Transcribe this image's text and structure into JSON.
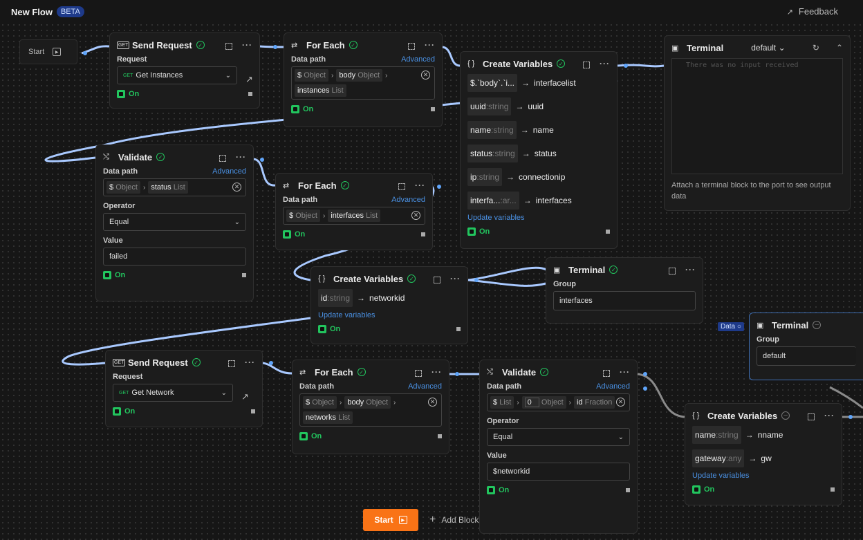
{
  "app": {
    "title": "New Flow",
    "badge": "BETA",
    "feedback": "Feedback"
  },
  "start_node": {
    "label": "Start"
  },
  "nodes": {
    "send1": {
      "title": "Send Request",
      "request_label": "Request",
      "method": "GET",
      "request_value": "Get Instances",
      "status": "On"
    },
    "foreach1": {
      "title": "For Each",
      "datapath_label": "Data path",
      "advanced": "Advanced",
      "chips": [
        [
          "$",
          "Object"
        ],
        [
          "body",
          "Object"
        ],
        [
          "instances",
          "List"
        ]
      ],
      "status": "On"
    },
    "createvars1": {
      "title": "Create Variables",
      "rows": [
        {
          "src": "$.`body`.`i...",
          "type": "",
          "target": "interfacelist"
        },
        {
          "src": "uuid",
          "type": ":string",
          "target": "uuid"
        },
        {
          "src": "name",
          "type": ":string",
          "target": "name"
        },
        {
          "src": "status",
          "type": ":string",
          "target": "status"
        },
        {
          "src": "ip",
          "type": ":string",
          "target": "connectionip"
        },
        {
          "src": "interfa...",
          "type": ":ar...",
          "target": "interfaces"
        }
      ],
      "update": "Update variables",
      "status": "On"
    },
    "terminal1": {
      "title": "Terminal",
      "group_value": "default",
      "placeholder": "There was no input received",
      "hint": "Attach a terminal block to the port to see output data"
    },
    "validate1": {
      "title": "Validate",
      "datapath_label": "Data path",
      "advanced": "Advanced",
      "chips": [
        [
          "$",
          "Object"
        ],
        [
          "status",
          "List"
        ]
      ],
      "operator_label": "Operator",
      "operator": "Equal",
      "value_label": "Value",
      "value": "failed",
      "status": "On"
    },
    "foreach2": {
      "title": "For Each",
      "datapath_label": "Data path",
      "advanced": "Advanced",
      "chips": [
        [
          "$",
          "Object"
        ],
        [
          "interfaces",
          "List"
        ]
      ],
      "status": "On"
    },
    "createvars2": {
      "title": "Create Variables",
      "rows": [
        {
          "src": "id",
          "type": ":string",
          "target": "networkid"
        }
      ],
      "update": "Update variables",
      "status": "On"
    },
    "terminal2": {
      "title": "Terminal",
      "group_label": "Group",
      "group_value": "interfaces"
    },
    "terminal3": {
      "title": "Terminal",
      "group_label": "Group",
      "group_value": "default",
      "data_tag": "Data"
    },
    "send2": {
      "title": "Send Request",
      "request_label": "Request",
      "method": "GET",
      "request_value": "Get Network",
      "status": "On"
    },
    "foreach3": {
      "title": "For Each",
      "datapath_label": "Data path",
      "advanced": "Advanced",
      "chips": [
        [
          "$",
          "Object"
        ],
        [
          "body",
          "Object"
        ],
        [
          "networks",
          "List"
        ]
      ],
      "status": "On"
    },
    "validate2": {
      "title": "Validate",
      "datapath_label": "Data path",
      "advanced": "Advanced",
      "chips": [
        [
          "$",
          "List"
        ],
        [
          "0",
          "Object"
        ],
        [
          "id",
          "Fraction"
        ]
      ],
      "operator_label": "Operator",
      "operator": "Equal",
      "value_label": "Value",
      "value": "$networkid",
      "status": "On"
    },
    "createvars3": {
      "title": "Create Variables",
      "rows": [
        {
          "src": "name",
          "type": ":string",
          "target": "nname"
        },
        {
          "src": "gateway",
          "type": ":any",
          "target": "gw"
        }
      ],
      "update": "Update variables",
      "status": "On"
    }
  },
  "bottom": {
    "start": "Start",
    "add_block": "Add Block"
  },
  "colors": {
    "accent": "#4a90e2",
    "ok": "#22c55e",
    "start": "#f97316"
  }
}
